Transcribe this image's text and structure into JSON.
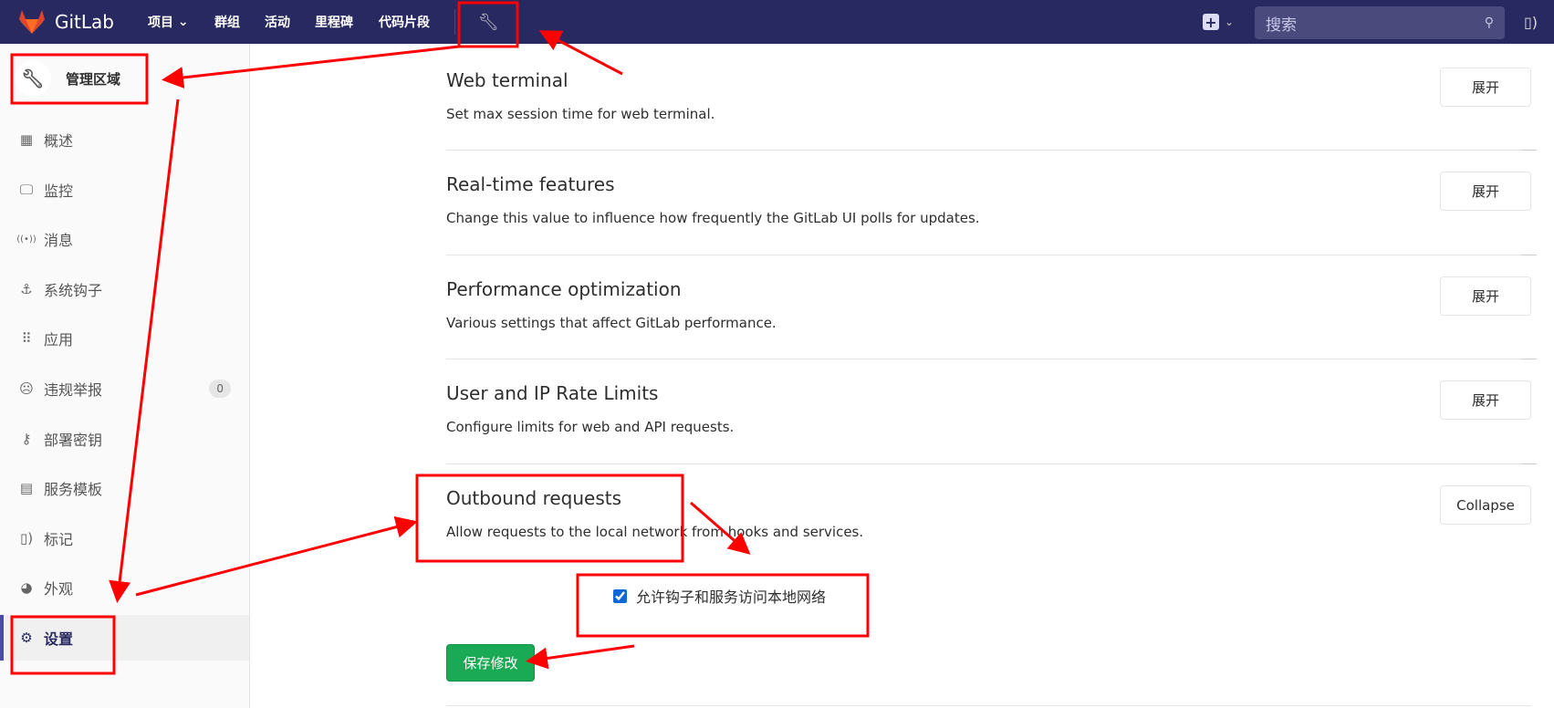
{
  "nav": {
    "brand": "GitLab",
    "items": [
      "项目",
      "群组",
      "活动",
      "里程碑",
      "代码片段"
    ],
    "search_placeholder": "搜索"
  },
  "sidebar": {
    "header": "管理区域",
    "items": [
      {
        "label": "概述",
        "icon": "overview-icon"
      },
      {
        "label": "监控",
        "icon": "monitor-icon"
      },
      {
        "label": "消息",
        "icon": "broadcast-icon"
      },
      {
        "label": "系统钩子",
        "icon": "hook-icon"
      },
      {
        "label": "应用",
        "icon": "apps-icon"
      },
      {
        "label": "违规举报",
        "icon": "abuse-icon",
        "badge": "0"
      },
      {
        "label": "部署密钥",
        "icon": "key-icon"
      },
      {
        "label": "服务模板",
        "icon": "template-icon"
      },
      {
        "label": "标记",
        "icon": "labels-icon"
      },
      {
        "label": "外观",
        "icon": "appearance-icon"
      },
      {
        "label": "设置",
        "icon": "gear-icon",
        "active": true
      }
    ]
  },
  "sections": [
    {
      "title": "Web terminal",
      "desc": "Set max session time for web terminal.",
      "button": "展开"
    },
    {
      "title": "Real-time features",
      "desc": "Change this value to influence how frequently the GitLab UI polls for updates.",
      "button": "展开"
    },
    {
      "title": "Performance optimization",
      "desc": "Various settings that affect GitLab performance.",
      "button": "展开"
    },
    {
      "title": "User and IP Rate Limits",
      "desc": "Configure limits for web and API requests.",
      "button": "展开"
    },
    {
      "title": "Outbound requests",
      "desc": "Allow requests to the local network from hooks and services.",
      "button": "Collapse"
    }
  ],
  "outbound": {
    "checkbox_label": "允许钩子和服务访问本地网络",
    "checked": true,
    "save": "保存修改"
  },
  "colors": {
    "nav": "#292961",
    "save": "#1aaa55",
    "annotation": "#ff0000"
  }
}
